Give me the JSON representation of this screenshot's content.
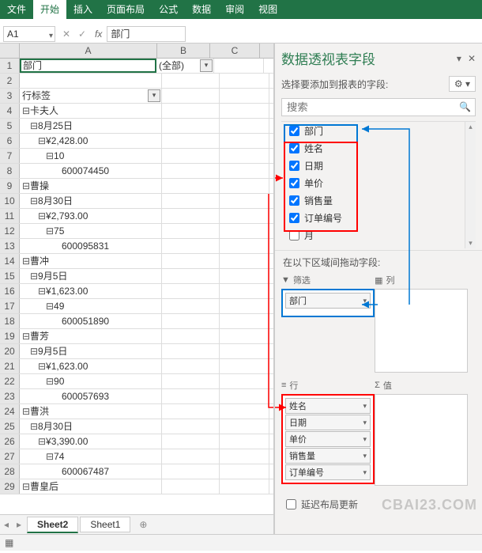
{
  "ribbon": {
    "tabs": [
      "文件",
      "开始",
      "插入",
      "页面布局",
      "公式",
      "数据",
      "审阅",
      "视图"
    ],
    "active": "开始"
  },
  "namebox": {
    "ref": "A1",
    "fx": "部门"
  },
  "cols": [
    "A",
    "B",
    "C"
  ],
  "rows": [
    {
      "n": 1,
      "a": "部门",
      "b": "(全部)",
      "ddA": false,
      "ddB": true,
      "sel": true
    },
    {
      "n": 2,
      "a": "",
      "b": ""
    },
    {
      "n": 3,
      "a": "行标签",
      "ddA": true
    },
    {
      "n": 4,
      "a": "⊟卡夫人"
    },
    {
      "n": 5,
      "a": "  ⊟8月25日"
    },
    {
      "n": 6,
      "a": "    ⊟¥2,428.00"
    },
    {
      "n": 7,
      "a": "      ⊟10"
    },
    {
      "n": 8,
      "a": "          600074450"
    },
    {
      "n": 9,
      "a": "⊟曹操"
    },
    {
      "n": 10,
      "a": "  ⊟8月30日"
    },
    {
      "n": 11,
      "a": "    ⊟¥2,793.00"
    },
    {
      "n": 12,
      "a": "      ⊟75"
    },
    {
      "n": 13,
      "a": "          600095831"
    },
    {
      "n": 14,
      "a": "⊟曹冲"
    },
    {
      "n": 15,
      "a": "  ⊟9月5日"
    },
    {
      "n": 16,
      "a": "    ⊟¥1,623.00"
    },
    {
      "n": 17,
      "a": "      ⊟49"
    },
    {
      "n": 18,
      "a": "          600051890"
    },
    {
      "n": 19,
      "a": "⊟曹芳"
    },
    {
      "n": 20,
      "a": "  ⊟9月5日"
    },
    {
      "n": 21,
      "a": "    ⊟¥1,623.00"
    },
    {
      "n": 22,
      "a": "      ⊟90"
    },
    {
      "n": 23,
      "a": "          600057693"
    },
    {
      "n": 24,
      "a": "⊟曹洪"
    },
    {
      "n": 25,
      "a": "  ⊟8月30日"
    },
    {
      "n": 26,
      "a": "    ⊟¥3,390.00"
    },
    {
      "n": 27,
      "a": "      ⊟74"
    },
    {
      "n": 28,
      "a": "          600067487"
    },
    {
      "n": 29,
      "a": "⊟曹皇后"
    }
  ],
  "sheets": {
    "tabs": [
      "Sheet2",
      "Sheet1"
    ],
    "active": "Sheet2"
  },
  "pane": {
    "title": "数据透视表字段",
    "subtitle": "选择要添加到报表的字段:",
    "search_ph": "搜索",
    "fields": [
      {
        "label": "部门",
        "checked": true
      },
      {
        "label": "姓名",
        "checked": true
      },
      {
        "label": "日期",
        "checked": true
      },
      {
        "label": "单价",
        "checked": true
      },
      {
        "label": "销售量",
        "checked": true
      },
      {
        "label": "订单编号",
        "checked": true
      },
      {
        "label": "月",
        "checked": false
      }
    ],
    "dragtitle": "在以下区域间拖动字段:",
    "areas": {
      "filter": {
        "label": "筛选",
        "items": [
          "部门"
        ]
      },
      "cols": {
        "label": "列",
        "items": []
      },
      "rows": {
        "label": "行",
        "items": [
          "姓名",
          "日期",
          "单价",
          "销售量",
          "订单编号"
        ]
      },
      "values": {
        "label": "值",
        "items": []
      }
    },
    "defer": "延迟布局更新"
  },
  "watermark": "CBAI23.COM"
}
